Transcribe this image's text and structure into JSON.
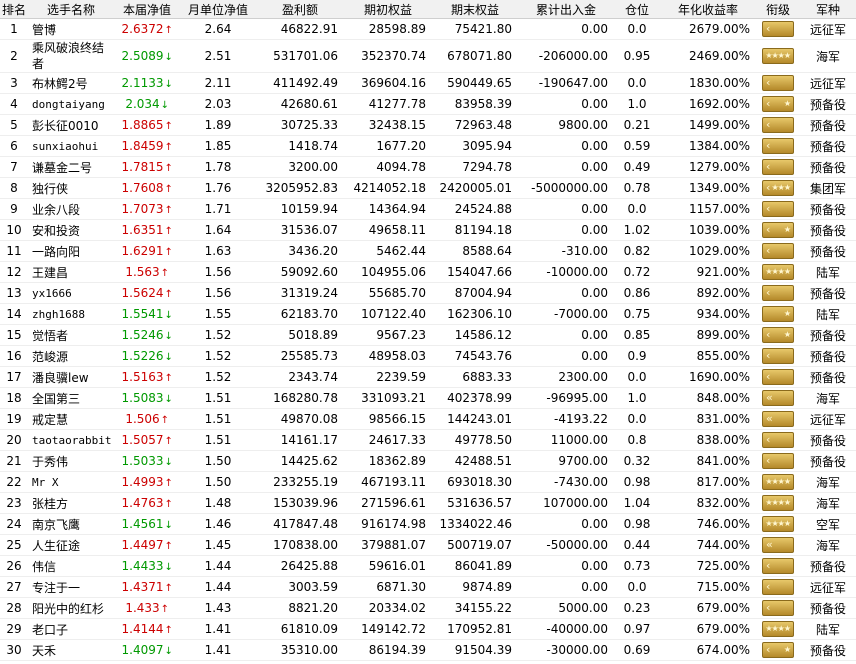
{
  "columns": [
    "排名",
    "选手名称",
    "本届净值",
    "月单位净值",
    "盈利额",
    "期初权益",
    "期末权益",
    "累计出入金",
    "仓位",
    "年化收益率",
    "衔级",
    "军种"
  ],
  "rows": [
    {
      "rank": "1",
      "name": "管博",
      "nav": "2.6372",
      "dir": "up",
      "month": "2.64",
      "profit": "46822.91",
      "start": "28598.89",
      "end": "75421.80",
      "flow": "0.00",
      "pos": "0.0",
      "ann": "2679.00%",
      "badge": "chevron-1",
      "branch": "远征军"
    },
    {
      "rank": "2",
      "name": "乘风破浪终结者",
      "nav": "2.5089",
      "dir": "down",
      "month": "2.51",
      "profit": "531701.06",
      "start": "352370.74",
      "end": "678071.80",
      "flow": "-206000.00",
      "pos": "0.95",
      "ann": "2469.00%",
      "badge": "stars-4",
      "branch": "海军"
    },
    {
      "rank": "3",
      "name": "布林鳄2号",
      "nav": "2.1133",
      "dir": "down",
      "month": "2.11",
      "profit": "411492.49",
      "start": "369604.16",
      "end": "590449.65",
      "flow": "-190647.00",
      "pos": "0.0",
      "ann": "1830.00%",
      "badge": "chevron-1",
      "branch": "远征军"
    },
    {
      "rank": "4",
      "name": "dongtaiyang",
      "nav": "2.034",
      "dir": "down",
      "month": "2.03",
      "profit": "42680.61",
      "start": "41277.78",
      "end": "83958.39",
      "flow": "0.00",
      "pos": "1.0",
      "ann": "1692.00%",
      "badge": "chevron-star",
      "branch": "预备役"
    },
    {
      "rank": "5",
      "name": "彭长征0010",
      "nav": "1.8865",
      "dir": "up",
      "month": "1.89",
      "profit": "30725.33",
      "start": "32438.15",
      "end": "72963.48",
      "flow": "9800.00",
      "pos": "0.21",
      "ann": "1499.00%",
      "badge": "chevron-1",
      "branch": "预备役"
    },
    {
      "rank": "6",
      "name": "sunxiaohui",
      "nav": "1.8459",
      "dir": "up",
      "month": "1.85",
      "profit": "1418.74",
      "start": "1677.20",
      "end": "3095.94",
      "flow": "0.00",
      "pos": "0.59",
      "ann": "1384.00%",
      "badge": "chevron-1",
      "branch": "预备役"
    },
    {
      "rank": "7",
      "name": "谦墓金二号",
      "nav": "1.7815",
      "dir": "up",
      "month": "1.78",
      "profit": "3200.00",
      "start": "4094.78",
      "end": "7294.78",
      "flow": "0.00",
      "pos": "0.49",
      "ann": "1279.00%",
      "badge": "chevron-1",
      "branch": "预备役"
    },
    {
      "rank": "8",
      "name": "独行侠",
      "nav": "1.7608",
      "dir": "up",
      "month": "1.76",
      "profit": "3205952.83",
      "start": "4214052.18",
      "end": "2420005.01",
      "flow": "-5000000.00",
      "pos": "0.78",
      "ann": "1349.00%",
      "badge": "chevron-stars",
      "branch": "集团军"
    },
    {
      "rank": "9",
      "name": "业余八段",
      "nav": "1.7073",
      "dir": "up",
      "month": "1.71",
      "profit": "10159.94",
      "start": "14364.94",
      "end": "24524.88",
      "flow": "0.00",
      "pos": "0.0",
      "ann": "1157.00%",
      "badge": "chevron-1",
      "branch": "预备役"
    },
    {
      "rank": "10",
      "name": "安和投资",
      "nav": "1.6351",
      "dir": "up",
      "month": "1.64",
      "profit": "31536.07",
      "start": "49658.11",
      "end": "81194.18",
      "flow": "0.00",
      "pos": "1.02",
      "ann": "1039.00%",
      "badge": "chevron-star",
      "branch": "预备役"
    },
    {
      "rank": "11",
      "name": "一路向阳",
      "nav": "1.6291",
      "dir": "up",
      "month": "1.63",
      "profit": "3436.20",
      "start": "5462.44",
      "end": "8588.64",
      "flow": "-310.00",
      "pos": "0.82",
      "ann": "1029.00%",
      "badge": "chevron-1",
      "branch": "预备役"
    },
    {
      "rank": "12",
      "name": "王建昌",
      "nav": "1.563",
      "dir": "up",
      "month": "1.56",
      "profit": "59092.60",
      "start": "104955.06",
      "end": "154047.66",
      "flow": "-10000.00",
      "pos": "0.72",
      "ann": "921.00%",
      "badge": "stars-4",
      "branch": "陆军"
    },
    {
      "rank": "13",
      "name": "yx1666",
      "nav": "1.5624",
      "dir": "up",
      "month": "1.56",
      "profit": "31319.24",
      "start": "55685.70",
      "end": "87004.94",
      "flow": "0.00",
      "pos": "0.86",
      "ann": "892.00%",
      "badge": "chevron-1",
      "branch": "预备役"
    },
    {
      "rank": "14",
      "name": "zhgh1688",
      "nav": "1.5541",
      "dir": "down",
      "month": "1.55",
      "profit": "62183.70",
      "start": "107122.40",
      "end": "162306.10",
      "flow": "-7000.00",
      "pos": "0.75",
      "ann": "934.00%",
      "badge": "star-1",
      "branch": "陆军"
    },
    {
      "rank": "15",
      "name": "觉悟者",
      "nav": "1.5246",
      "dir": "down",
      "month": "1.52",
      "profit": "5018.89",
      "start": "9567.23",
      "end": "14586.12",
      "flow": "0.00",
      "pos": "0.85",
      "ann": "899.00%",
      "badge": "chevron-star",
      "branch": "预备役"
    },
    {
      "rank": "16",
      "name": "范峻源",
      "nav": "1.5226",
      "dir": "down",
      "month": "1.52",
      "profit": "25585.73",
      "start": "48958.03",
      "end": "74543.76",
      "flow": "0.00",
      "pos": "0.9",
      "ann": "855.00%",
      "badge": "chevron-1",
      "branch": "预备役"
    },
    {
      "rank": "17",
      "name": "潘良骥lew",
      "nav": "1.5163",
      "dir": "up",
      "month": "1.52",
      "profit": "2343.74",
      "start": "2239.59",
      "end": "6883.33",
      "flow": "2300.00",
      "pos": "0.0",
      "ann": "1690.00%",
      "badge": "chevron-1",
      "branch": "预备役"
    },
    {
      "rank": "18",
      "name": "全国第三",
      "nav": "1.5083",
      "dir": "down",
      "month": "1.51",
      "profit": "168280.78",
      "start": "331093.21",
      "end": "402378.99",
      "flow": "-96995.00",
      "pos": "1.0",
      "ann": "848.00%",
      "badge": "chevron-2",
      "branch": "海军"
    },
    {
      "rank": "19",
      "name": "戒定慧",
      "nav": "1.506",
      "dir": "up",
      "month": "1.51",
      "profit": "49870.08",
      "start": "98566.15",
      "end": "144243.01",
      "flow": "-4193.22",
      "pos": "0.0",
      "ann": "831.00%",
      "badge": "chevron-2",
      "branch": "远征军"
    },
    {
      "rank": "20",
      "name": "taotaorabbit",
      "nav": "1.5057",
      "dir": "up",
      "month": "1.51",
      "profit": "14161.17",
      "start": "24617.33",
      "end": "49778.50",
      "flow": "11000.00",
      "pos": "0.8",
      "ann": "838.00%",
      "badge": "chevron-1",
      "branch": "预备役"
    },
    {
      "rank": "21",
      "name": "于秀伟",
      "nav": "1.5033",
      "dir": "down",
      "month": "1.50",
      "profit": "14425.62",
      "start": "18362.89",
      "end": "42488.51",
      "flow": "9700.00",
      "pos": "0.32",
      "ann": "841.00%",
      "badge": "chevron-1",
      "branch": "预备役"
    },
    {
      "rank": "22",
      "name": "Mr X",
      "nav": "1.4993",
      "dir": "up",
      "month": "1.50",
      "profit": "233255.19",
      "start": "467193.11",
      "end": "693018.30",
      "flow": "-7430.00",
      "pos": "0.98",
      "ann": "817.00%",
      "badge": "stars-4",
      "branch": "海军"
    },
    {
      "rank": "23",
      "name": "张桂方",
      "nav": "1.4763",
      "dir": "up",
      "month": "1.48",
      "profit": "153039.96",
      "start": "271596.61",
      "end": "531636.57",
      "flow": "107000.00",
      "pos": "1.04",
      "ann": "832.00%",
      "badge": "stars-4",
      "branch": "海军"
    },
    {
      "rank": "24",
      "name": "南京飞鹰",
      "nav": "1.4561",
      "dir": "down",
      "month": "1.46",
      "profit": "417847.48",
      "start": "916174.98",
      "end": "1334022.46",
      "flow": "0.00",
      "pos": "0.98",
      "ann": "746.00%",
      "badge": "stars-4",
      "branch": "空军"
    },
    {
      "rank": "25",
      "name": "人生征途",
      "nav": "1.4497",
      "dir": "up",
      "month": "1.45",
      "profit": "170838.00",
      "start": "379881.07",
      "end": "500719.07",
      "flow": "-50000.00",
      "pos": "0.44",
      "ann": "744.00%",
      "badge": "chevron-2",
      "branch": "海军"
    },
    {
      "rank": "26",
      "name": "伟信",
      "nav": "1.4433",
      "dir": "down",
      "month": "1.44",
      "profit": "26425.88",
      "start": "59616.01",
      "end": "86041.89",
      "flow": "0.00",
      "pos": "0.73",
      "ann": "725.00%",
      "badge": "chevron-1",
      "branch": "预备役"
    },
    {
      "rank": "27",
      "name": "专注于一",
      "nav": "1.4371",
      "dir": "up",
      "month": "1.44",
      "profit": "3003.59",
      "start": "6871.30",
      "end": "9874.89",
      "flow": "0.00",
      "pos": "0.0",
      "ann": "715.00%",
      "badge": "chevron-1",
      "branch": "远征军"
    },
    {
      "rank": "28",
      "name": "阳光中的红杉",
      "nav": "1.433",
      "dir": "up",
      "month": "1.43",
      "profit": "8821.20",
      "start": "20334.02",
      "end": "34155.22",
      "flow": "5000.00",
      "pos": "0.23",
      "ann": "679.00%",
      "badge": "chevron-1",
      "branch": "预备役"
    },
    {
      "rank": "29",
      "name": "老口子",
      "nav": "1.4144",
      "dir": "up",
      "month": "1.41",
      "profit": "61810.09",
      "start": "149142.72",
      "end": "170952.81",
      "flow": "-40000.00",
      "pos": "0.97",
      "ann": "679.00%",
      "badge": "stars-4",
      "branch": "陆军"
    },
    {
      "rank": "30",
      "name": "天禾",
      "nav": "1.4097",
      "dir": "down",
      "month": "1.41",
      "profit": "35310.00",
      "start": "86194.39",
      "end": "91504.39",
      "flow": "-30000.00",
      "pos": "0.69",
      "ann": "674.00%",
      "badge": "chevron-star",
      "branch": "预备役"
    }
  ]
}
